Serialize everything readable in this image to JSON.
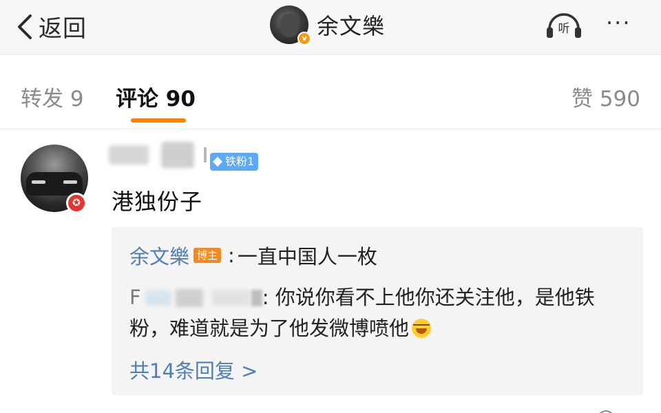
{
  "topbar": {
    "back_label": "返回",
    "author_name": "余文樂",
    "author_verified_badge": "v",
    "listen_label": "听",
    "more_label": "···"
  },
  "tabs": {
    "repost_label": "转发 9",
    "comments_label": "评论 90",
    "likes_label": "赞 590",
    "active_color": "#ff8200"
  },
  "comment": {
    "fan_badge": "铁粉1",
    "text": "港独份子",
    "user_badge_icon": "red-star-badge-icon",
    "replies": {
      "reply1": {
        "name": "余文樂",
        "badge": "博主",
        "colon": ":",
        "text": "一直中国人一枚"
      },
      "reply2": {
        "initial": "F",
        "colon": ":",
        "text": "你说你看不上他你还关注他，是他铁粉，难道就是为了他发微博喷他"
      },
      "more_label": "共14条回复 >"
    }
  },
  "colors": {
    "link_blue": "#4f7db5",
    "host_badge": "#f08a24",
    "fan_badge": "#5ea9f5",
    "topbar_bg": "#f7f7f7",
    "reply_bg": "#f4f4f4"
  }
}
